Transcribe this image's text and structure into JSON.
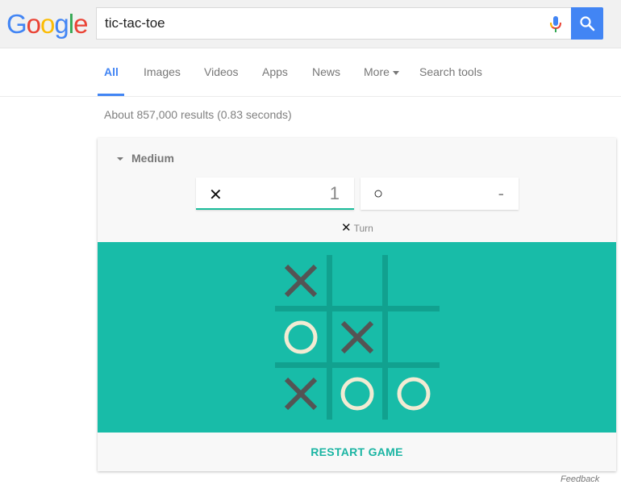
{
  "header": {
    "logo_letters": [
      {
        "char": "G",
        "color": "#4285f4"
      },
      {
        "char": "o",
        "color": "#ea4335"
      },
      {
        "char": "o",
        "color": "#fbbc05"
      },
      {
        "char": "g",
        "color": "#4285f4"
      },
      {
        "char": "l",
        "color": "#34a853"
      },
      {
        "char": "e",
        "color": "#ea4335"
      }
    ],
    "search_query": "tic-tac-toe",
    "mic_icon": "microphone-icon",
    "search_icon": "magnifier-icon"
  },
  "nav": {
    "tabs": [
      {
        "label": "All",
        "active": true
      },
      {
        "label": "Images",
        "active": false
      },
      {
        "label": "Videos",
        "active": false
      },
      {
        "label": "Apps",
        "active": false
      },
      {
        "label": "News",
        "active": false
      },
      {
        "label": "More",
        "active": false
      },
      {
        "label": "Search tools",
        "active": false
      }
    ]
  },
  "results_stats": "About 857,000 results (0.83 seconds)",
  "game": {
    "difficulty": "Medium",
    "score_x": {
      "symbol": "✕",
      "value": "1"
    },
    "score_o": {
      "symbol": "○",
      "value": "-"
    },
    "turn": {
      "symbol": "✕",
      "label": "Turn"
    },
    "board": [
      [
        "X",
        "",
        ""
      ],
      [
        "O",
        "X",
        ""
      ],
      [
        "X",
        "O",
        "O"
      ]
    ],
    "colors": {
      "board_bg": "#18bca8",
      "grid": "#11a18f",
      "x_mark": "#545454",
      "o_mark": "#f2ebd3",
      "accent": "#1bbc9b"
    },
    "restart_label": "RESTART GAME"
  },
  "footer": {
    "feedback_label": "Feedback"
  }
}
